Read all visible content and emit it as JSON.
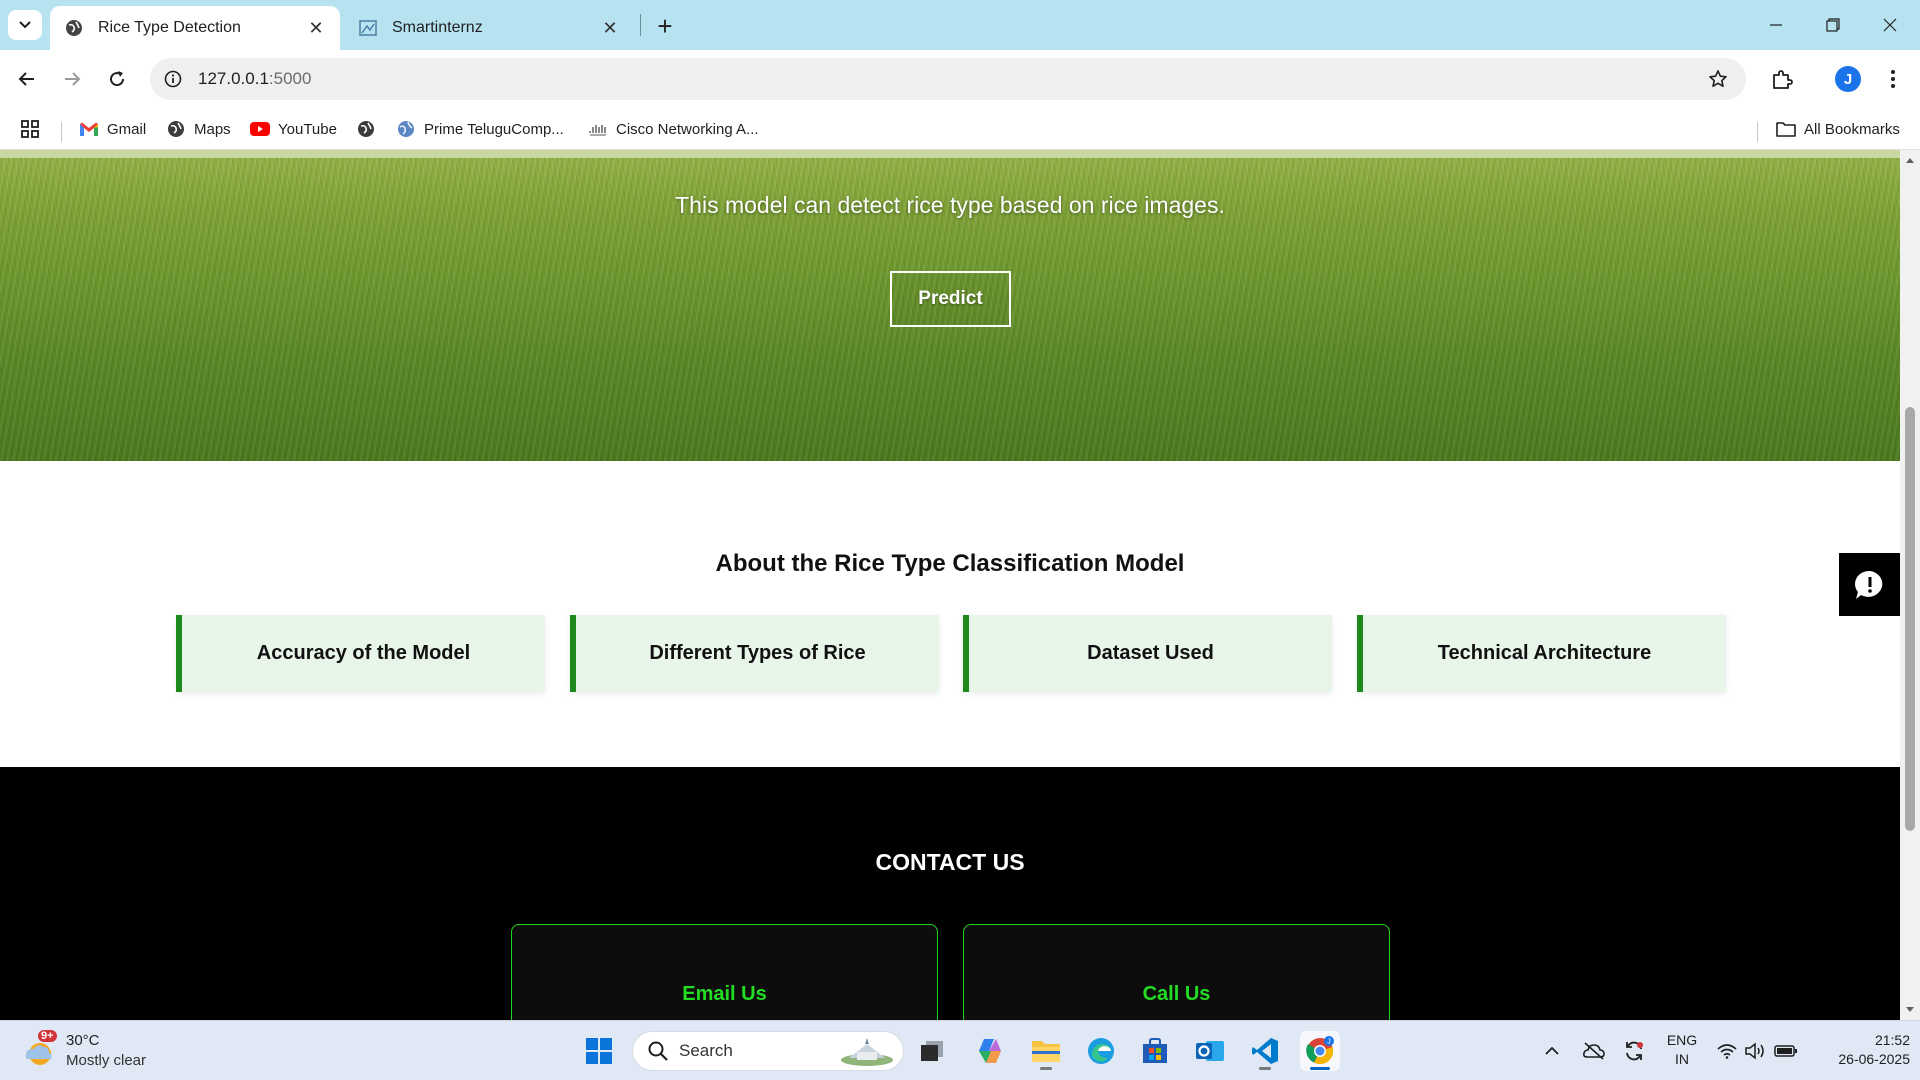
{
  "browser": {
    "tabs": [
      {
        "title": "Rice Type Detection",
        "active": true
      },
      {
        "title": "Smartinternz",
        "active": false
      }
    ],
    "address": {
      "host": "127.0.0.1",
      "port": ":5000"
    },
    "bookmarks": [
      {
        "label": "Gmail",
        "icon": "gmail-icon"
      },
      {
        "label": "Maps",
        "icon": "maps-icon"
      },
      {
        "label": "YouTube",
        "icon": "youtube-icon"
      },
      {
        "label": "",
        "icon": "globe-icon"
      },
      {
        "label": "Prime TeluguComp...",
        "icon": "globe-icon"
      },
      {
        "label": "Cisco Networking A...",
        "icon": "cisco-icon"
      }
    ],
    "all_bookmarks_label": "All Bookmarks",
    "profile_initial": "J"
  },
  "page": {
    "hero": {
      "subtitle": "This model can detect rice type based on rice images.",
      "predict_label": "Predict"
    },
    "about": {
      "title": "About the Rice Type Classification Model",
      "cards": [
        "Accuracy of the Model",
        "Different Types of Rice",
        "Dataset Used",
        "Technical Architecture"
      ]
    },
    "contact": {
      "title": "CONTACT US",
      "cards": [
        "Email Us",
        "Call Us"
      ]
    }
  },
  "taskbar": {
    "weather": {
      "temp": "30°C",
      "condition": "Mostly clear",
      "badge": "9+"
    },
    "search_placeholder": "Search",
    "lang": {
      "line1": "ENG",
      "line2": "IN"
    },
    "clock": {
      "time": "21:52",
      "date": "26-06-2025"
    }
  },
  "colors": {
    "accent_green": "#1e8a1e",
    "contact_green": "#22dd22",
    "tab_strip": "#b6e3ef"
  }
}
